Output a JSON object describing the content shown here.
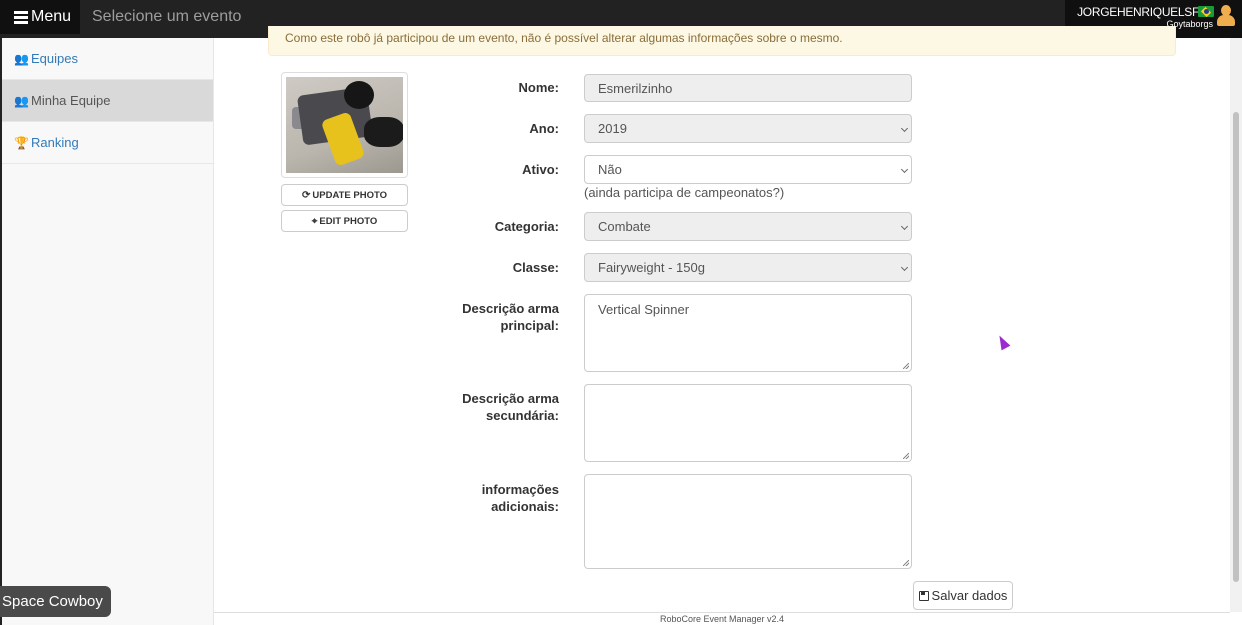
{
  "navbar": {
    "menu_label": "Menu",
    "event_selector": "Selecione um evento",
    "user_name": "JORGEHENRIQUELSF",
    "user_team": "Goytaborgs"
  },
  "sidebar": {
    "items": [
      {
        "label": "Equipes",
        "icon": "users-icon"
      },
      {
        "label": "Minha Equipe",
        "icon": "users-icon",
        "active": true
      },
      {
        "label": "Ranking",
        "icon": "trophy-icon"
      }
    ]
  },
  "alert": {
    "text": "Como este robô já participou de um evento, não é possível alterar algumas informações sobre o mesmo."
  },
  "photo": {
    "update_label": "UPDATE PHOTO",
    "edit_label": "EDIT PHOTO"
  },
  "form": {
    "nome": {
      "label": "Nome:",
      "value": "Esmerilzinho"
    },
    "ano": {
      "label": "Ano:",
      "value": "2019"
    },
    "ativo": {
      "label": "Ativo:",
      "value": "Não",
      "help": "(ainda participa de campeonatos?)"
    },
    "categoria": {
      "label": "Categoria:",
      "value": "Combate"
    },
    "classe": {
      "label": "Classe:",
      "value": "Fairyweight - 150g"
    },
    "arma_principal": {
      "label_line1": "Descrição arma",
      "label_line2": "principal:",
      "value": "Vertical Spinner"
    },
    "arma_secundaria": {
      "label_line1": "Descrição arma",
      "label_line2": "secundária:",
      "value": ""
    },
    "info": {
      "label_line1": "informações",
      "label_line2": "adicionais:",
      "value": ""
    },
    "save_label": "Salvar dados"
  },
  "footer": {
    "text": "RoboCore Event Manager v2.4"
  },
  "toast": {
    "text": "Space Cowboy"
  }
}
